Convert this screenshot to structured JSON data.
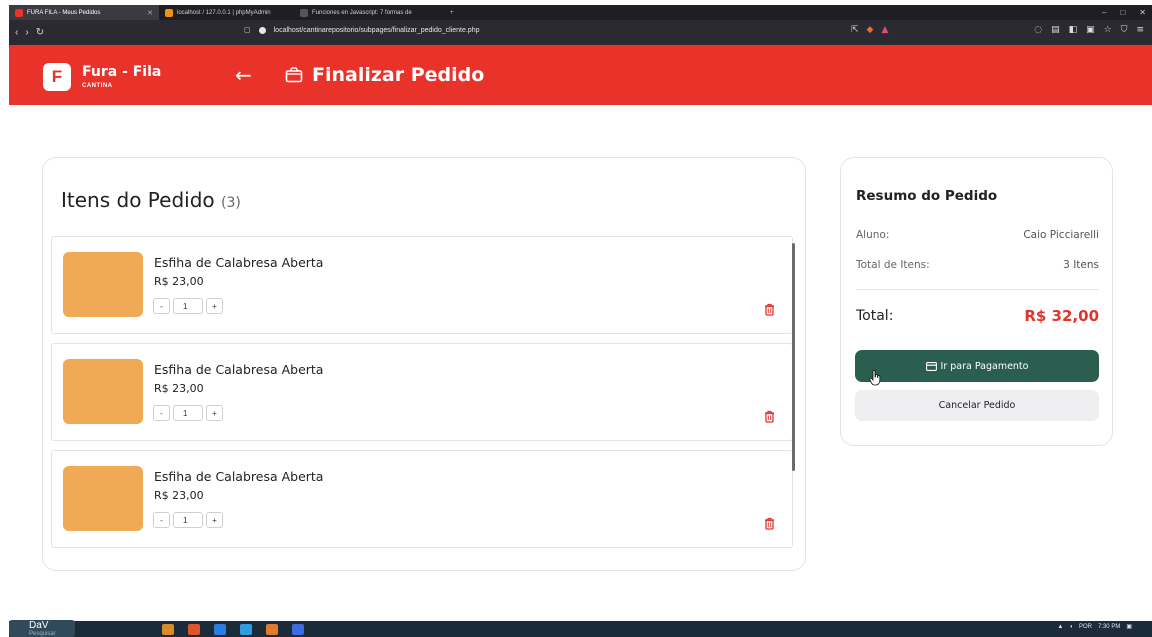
{
  "browser": {
    "tabs": [
      {
        "title": "FURA FILA - Meus Pedidos",
        "icon": "app-favicon",
        "color": "#e8322a"
      },
      {
        "title": "localhost / 127.0.0.1 | phpMyAdmin",
        "icon": "phpmyadmin-favicon",
        "color": "#f29111"
      },
      {
        "title": "Funciones en Javascript: 7 formas de",
        "icon": "site-favicon",
        "color": "#444444"
      }
    ],
    "new_tab": "+",
    "url": "localhost/cantinarepositorio/subpages/finalizar_pedido_cliente.php",
    "window_controls": [
      "–",
      "□",
      "✕"
    ]
  },
  "header": {
    "logo_letter": "F",
    "brand": "Fura - Fila",
    "brand_sub": "CANTINA",
    "back_icon": "arrow-left-icon",
    "title_icon": "shopping-bag-icon",
    "title": "Finalizar Pedido",
    "bg_color": "#e8322a"
  },
  "items": {
    "heading": "Itens do Pedido",
    "count": "(3)",
    "list": [
      {
        "name": "Esfiha de Calabresa Aberta",
        "price": "R$ 23,00",
        "qty": "1",
        "minus": "-",
        "plus": "+"
      },
      {
        "name": "Esfiha de Calabresa Aberta",
        "price": "R$ 23,00",
        "qty": "1",
        "minus": "-",
        "plus": "+"
      },
      {
        "name": "Esfiha de Calabresa Aberta",
        "price": "R$ 23,00",
        "qty": "1",
        "minus": "-",
        "plus": "+"
      }
    ]
  },
  "summary": {
    "title": "Resumo do Pedido",
    "student_label": "Aluno:",
    "student_value": "Caio Picciarelli",
    "items_label": "Total de Itens:",
    "items_value": "3 Itens",
    "total_label": "Total:",
    "total_value": "R$ 32,00",
    "pay_button": "Ir para Pagamento",
    "cancel_button": "Cancelar Pedido",
    "accent": "#2a5e4f",
    "total_color": "#e0342c"
  },
  "taskbar": {
    "dav_label": "DaV",
    "search_placeholder": "Pesquisar",
    "tray_lang": "POR",
    "tray_time": "7:30 PM"
  }
}
